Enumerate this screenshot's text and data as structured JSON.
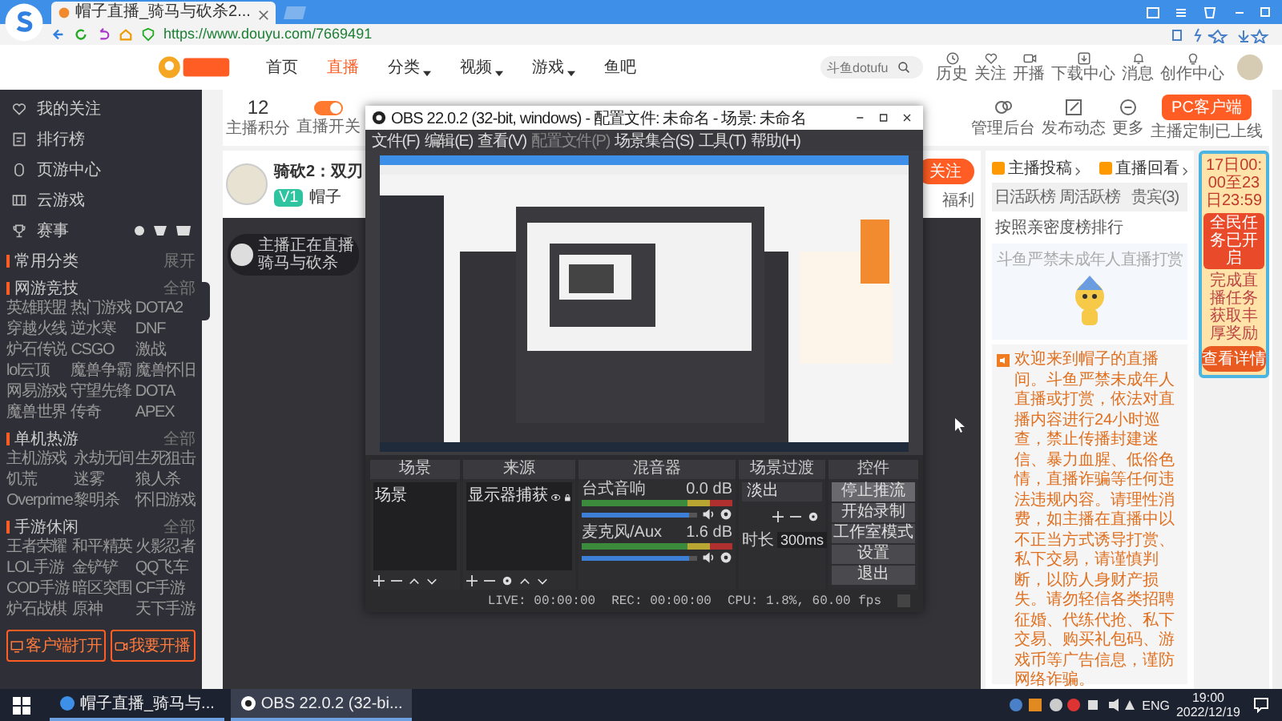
{
  "browser": {
    "tab_title": "帽子直播_骑马与砍杀2...",
    "url": "https://www.douyu.com/7669491"
  },
  "site_header": {
    "nav": [
      {
        "label": "首页",
        "selected": false,
        "caret": false
      },
      {
        "label": "直播",
        "selected": true,
        "caret": false
      },
      {
        "label": "分类",
        "selected": false,
        "caret": true
      },
      {
        "label": "视频",
        "selected": false,
        "caret": true
      },
      {
        "label": "游戏",
        "selected": false,
        "caret": true
      },
      {
        "label": "鱼吧",
        "selected": false,
        "caret": false
      }
    ],
    "search": {
      "placeholder": "斗鱼dotufu"
    },
    "actions": [
      {
        "kind": "clock",
        "label": "历史"
      },
      {
        "kind": "heart",
        "label": "关注"
      },
      {
        "kind": "video",
        "label": "开播"
      },
      {
        "kind": "download",
        "label": "下载中心"
      },
      {
        "kind": "bell",
        "label": "消息"
      },
      {
        "kind": "bulb",
        "label": "创作中心"
      }
    ]
  },
  "sidebar": {
    "nav": [
      {
        "kind": "heart",
        "label": "我的关注"
      },
      {
        "kind": "rank",
        "label": "排行榜"
      },
      {
        "kind": "game",
        "label": "页游中心"
      },
      {
        "kind": "cloud",
        "label": "云游戏"
      },
      {
        "kind": "trophy",
        "label": "赛事"
      }
    ],
    "sections": [
      {
        "title": "常用分类",
        "more": "展开"
      },
      {
        "title": "网游竞技",
        "more": "全部",
        "items": [
          "英雄联盟",
          "热门游戏",
          "DOTA2",
          "穿越火线",
          "逆水寒",
          "DNF",
          "炉石传说",
          "CSGO",
          "激战",
          "lol云顶",
          "魔兽争霸",
          "魔兽怀旧",
          "网易游戏",
          "守望先锋",
          "DOTA",
          "魔兽世界",
          "传奇",
          "APEX"
        ]
      },
      {
        "title": "单机热游",
        "more": "全部",
        "items": [
          "主机游戏",
          "永劫无间",
          "生死狙击",
          "饥荒",
          "迷雾",
          "狼人杀",
          "Overprime",
          "黎明杀",
          "怀旧游戏"
        ]
      },
      {
        "title": "手游休闲",
        "more": "全部",
        "items": [
          "王者荣耀",
          "和平精英",
          "火影忍者",
          "LOL手游",
          "金铲铲",
          "QQ飞车",
          "COD手游",
          "暗区突围",
          "CF手游",
          "炉石战棋",
          "原神",
          "天下手游"
        ]
      }
    ],
    "buttons": [
      {
        "kind": "client",
        "label": "客户端打开"
      },
      {
        "kind": "live",
        "label": "我要开播"
      }
    ]
  },
  "toolbar": {
    "points": "12",
    "points_label": "主播积分",
    "live_switch": {
      "label": "直播开关",
      "on": true
    },
    "tools": [
      {
        "kind": "chart",
        "label": "管理后台"
      },
      {
        "kind": "edit",
        "label": "发布动态"
      },
      {
        "kind": "more",
        "label": "更多"
      }
    ],
    "client_button": "PC客户端",
    "client_note": "主播定制已上线"
  },
  "streamer": {
    "title": "骑砍2：双刃",
    "level": "V1",
    "name": "帽子",
    "follow": "关注",
    "links": [
      "福利"
    ]
  },
  "video": {
    "badge": [
      "主播正在直播",
      "骑马与砍杀"
    ]
  },
  "right_panel": {
    "links": [
      "主播投稿",
      "直播回看"
    ],
    "tabs": [
      {
        "label": "日活跃榜",
        "selected": false
      },
      {
        "label": "周活跃榜",
        "selected": false
      },
      {
        "label": "贵宾(3)",
        "selected": false
      }
    ],
    "rank_hint": "按照亲密度榜排行",
    "empty_text": "斗鱼严禁未成年人直播打赏",
    "notice": "欢迎来到帽子的直播间。斗鱼严禁未成年人直播或打赏，依法对直播内容进行24小时巡查，禁止传播封建迷信、暴力血腥、低俗色情，直播诈骗等任何违法违规内容。请理性消费，如主播在直播中以不正当方式诱导打赏、私下交易，请谨慎判断，以防人身财产损失。请勿轻信各类招聘征婚、代练代抢、私下交易、购买礼包码、游戏币等广告信息，谨防网络诈骗。"
  },
  "promo": {
    "date": "17日00:00至23日23:59",
    "headline": "全民任务已开启",
    "text": "完成直播任务获取丰厚奖励",
    "button": "查看详情"
  },
  "obs": {
    "title": "OBS 22.0.2 (32-bit, windows) - 配置文件: 未命名 - 场景: 未命名",
    "menu": [
      "文件(F)",
      "编辑(E)",
      "查看(V)",
      "配置文件(P)",
      "场景集合(S)",
      "工具(T)",
      "帮助(H)"
    ],
    "scenes": {
      "title": "场景",
      "items": [
        {
          "label": "场景",
          "selected": false
        }
      ]
    },
    "sources": {
      "title": "来源",
      "items": [
        {
          "label": "显示器捕获",
          "visible": true
        }
      ]
    },
    "mixer": {
      "title": "混音器",
      "channels": [
        {
          "name": "台式音响",
          "reading": "0.0 dB",
          "level": 0.93
        },
        {
          "name": "麦克风/Aux",
          "reading": "1.6 dB",
          "level": 0.93
        }
      ]
    },
    "transitions": {
      "title": "场景过渡",
      "type": "淡出",
      "duration_label": "时长",
      "duration": "300ms"
    },
    "controls": {
      "title": "控件",
      "buttons": [
        {
          "label": "停止推流",
          "active": true
        },
        {
          "label": "开始录制",
          "active": false
        },
        {
          "label": "工作室模式",
          "active": false
        },
        {
          "label": "设置",
          "active": false
        },
        {
          "label": "退出",
          "active": false
        }
      ]
    },
    "status": [
      "LIVE: 00:00:00",
      "REC: 00:00:00",
      "CPU: 1.8%, 60.00 fps"
    ]
  },
  "taskbar": {
    "tasks": [
      {
        "kind": "browser",
        "label": "帽子直播_骑马与...",
        "selected": false
      },
      {
        "kind": "obs",
        "label": "OBS 22.0.2 (32-bi...",
        "selected": true
      }
    ],
    "lang": "ENG",
    "time": "19:00",
    "date": "2022/12/19"
  }
}
